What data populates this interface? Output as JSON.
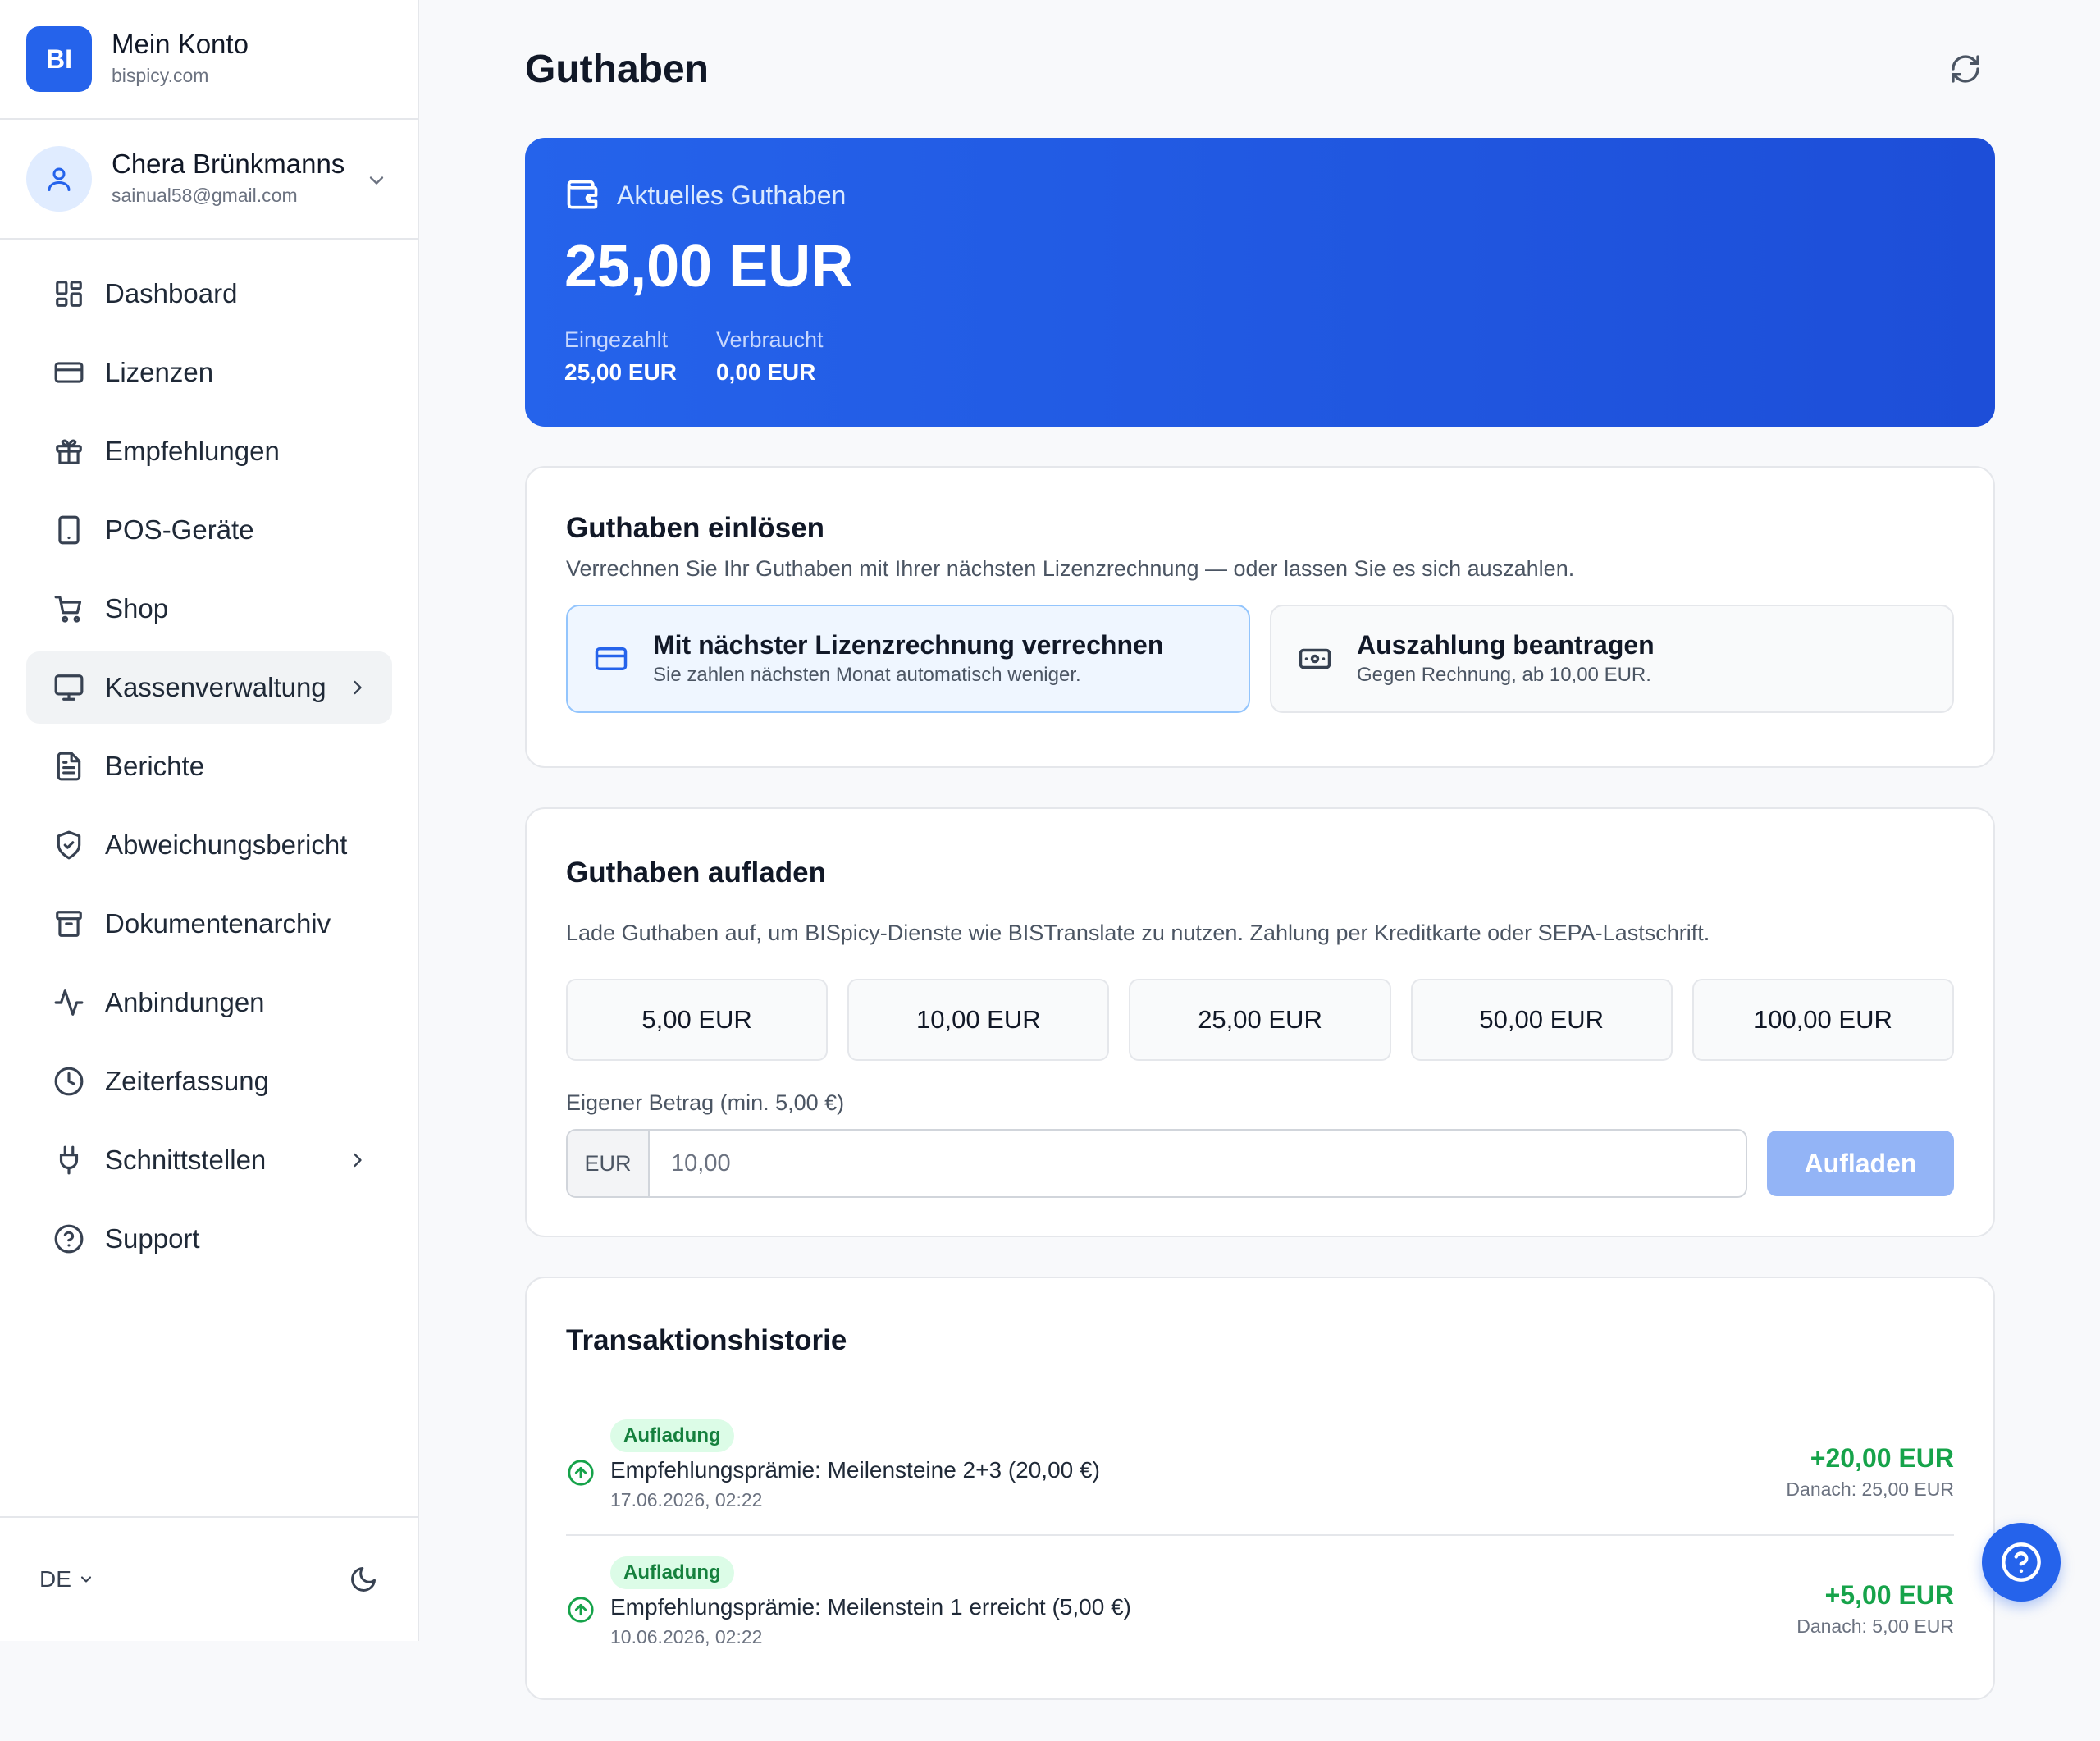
{
  "brand": {
    "logo_text": "BI",
    "title": "Mein Konto",
    "subtitle": "bispicy.com"
  },
  "user": {
    "name": "Chera Brünkmanns",
    "email": "sainual58@gmail.com"
  },
  "sidebar": {
    "items": [
      {
        "label": "Dashboard",
        "icon": "dashboard-icon"
      },
      {
        "label": "Lizenzen",
        "icon": "credit-card-icon"
      },
      {
        "label": "Empfehlungen",
        "icon": "gift-icon"
      },
      {
        "label": "POS-Geräte",
        "icon": "tablet-icon"
      },
      {
        "label": "Shop",
        "icon": "cart-icon"
      },
      {
        "label": "Kassenverwaltung",
        "icon": "monitor-icon",
        "active": true,
        "has_submenu": true
      },
      {
        "label": "Berichte",
        "icon": "document-icon"
      },
      {
        "label": "Abweichungsbericht",
        "icon": "shield-check-icon"
      },
      {
        "label": "Dokumentenarchiv",
        "icon": "archive-icon"
      },
      {
        "label": "Anbindungen",
        "icon": "activity-icon"
      },
      {
        "label": "Zeiterfassung",
        "icon": "clock-icon"
      },
      {
        "label": "Schnittstellen",
        "icon": "plug-icon",
        "has_submenu": true
      },
      {
        "label": "Support",
        "icon": "help-circle-icon"
      }
    ],
    "footer": {
      "language": "DE",
      "theme_icon": "moon-icon"
    }
  },
  "page": {
    "title": "Guthaben",
    "refresh_icon": "refresh-icon"
  },
  "balance": {
    "label": "Aktuelles Guthaben",
    "amount": "25,00 EUR",
    "deposited_label": "Eingezahlt",
    "deposited_value": "25,00 EUR",
    "used_label": "Verbraucht",
    "used_value": "0,00 EUR"
  },
  "redeem": {
    "title": "Guthaben einlösen",
    "description": "Verrechnen Sie Ihr Guthaben mit Ihrer nächsten Lizenzrechnung — oder lassen Sie es sich auszahlen.",
    "options": [
      {
        "title": "Mit nächster Lizenzrechnung verrechnen",
        "description": "Sie zahlen nächsten Monat automatisch weniger.",
        "icon": "credit-card-icon",
        "selected": true
      },
      {
        "title": "Auszahlung beantragen",
        "description": "Gegen Rechnung, ab 10,00 EUR.",
        "icon": "banknote-icon",
        "selected": false
      }
    ]
  },
  "topup": {
    "title": "Guthaben aufladen",
    "description": "Lade Guthaben auf, um BISpicy-Dienste wie BISTranslate zu nutzen. Zahlung per Kreditkarte oder SEPA-Lastschrift.",
    "amounts": [
      "5,00 EUR",
      "10,00 EUR",
      "25,00 EUR",
      "50,00 EUR",
      "100,00 EUR"
    ],
    "custom_label": "Eigener Betrag (min. 5,00 €)",
    "currency_prefix": "EUR",
    "input_placeholder": "10,00",
    "button_label": "Aufladen"
  },
  "history": {
    "title": "Transaktionshistorie",
    "transactions": [
      {
        "badge": "Aufladung",
        "text": "Empfehlungsprämie: Meilensteine 2+3 (20,00 €)",
        "date": "17.06.2026, 02:22",
        "amount": "+20,00 EUR",
        "after": "Danach: 25,00 EUR"
      },
      {
        "badge": "Aufladung",
        "text": "Empfehlungsprämie: Meilenstein 1 erreicht (5,00 €)",
        "date": "10.06.2026, 02:22",
        "amount": "+5,00 EUR",
        "after": "Danach: 5,00 EUR"
      }
    ]
  },
  "help_button_icon": "help-circle-icon",
  "colors": {
    "accent": "#2563eb",
    "positive": "#16a34a",
    "badge_bg": "#dcfce7"
  }
}
